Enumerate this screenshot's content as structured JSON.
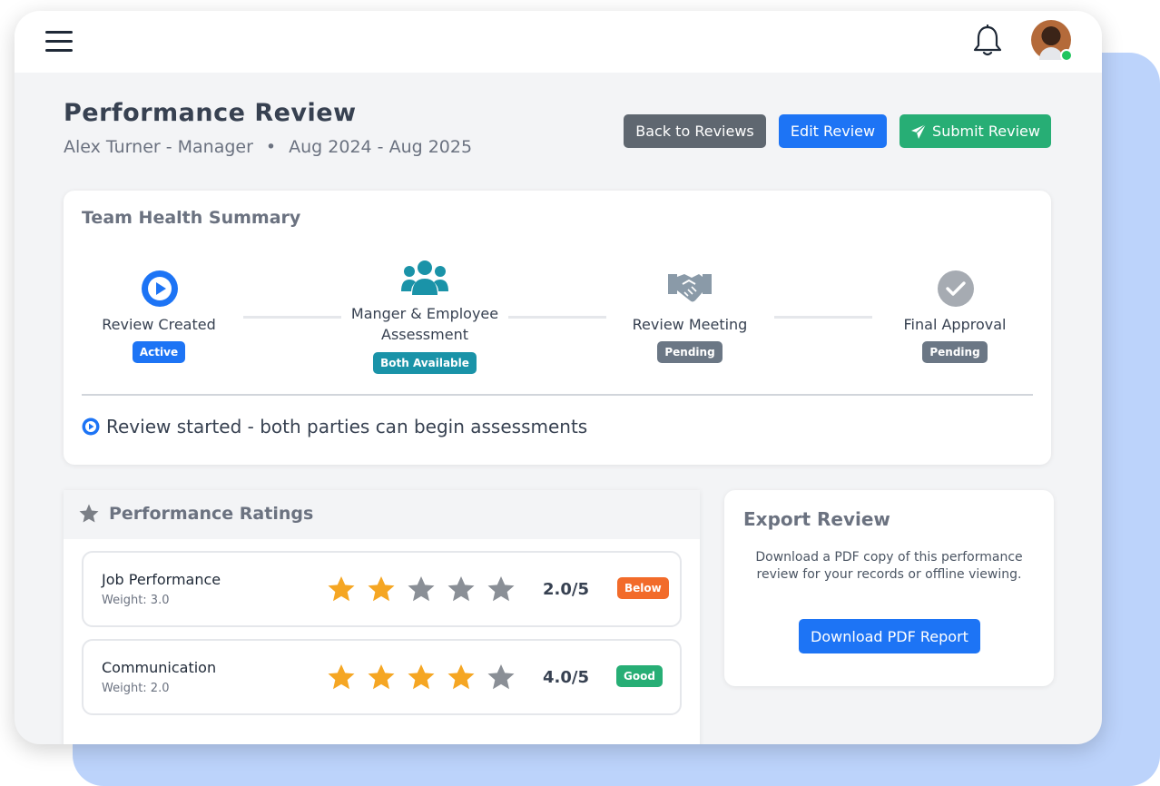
{
  "header": {
    "menu_icon": "hamburger-menu-icon",
    "notifications_icon": "bell-icon",
    "avatar_status": "online"
  },
  "page": {
    "title": "Performance Review",
    "employee": "Alex Turner - Manager",
    "separator": "•",
    "period": "Aug 2024 - Aug 2025"
  },
  "actions": {
    "back_label": "Back to Reviews",
    "edit_label": "Edit Review",
    "submit_label": "Submit Review",
    "submit_icon": "paper-plane-icon"
  },
  "team_health": {
    "title": "Team Health Summary",
    "steps": [
      {
        "icon": "play-circle-icon",
        "label": "Review Created",
        "badge": "Active",
        "badge_color": "#1d74f5"
      },
      {
        "icon": "users-icon",
        "label_line1": "Manger & Employee",
        "label_line2": "Assessment",
        "badge": "Both Available",
        "badge_color": "#1a93a8"
      },
      {
        "icon": "handshake-icon",
        "label": "Review Meeting",
        "badge": "Pending",
        "badge_color": "#6b7785"
      },
      {
        "icon": "check-circle-icon",
        "label": "Final Approval",
        "badge": "Pending",
        "badge_color": "#6b7785"
      }
    ],
    "status_text": "Review started - both parties can begin assessments"
  },
  "ratings": {
    "title": "Performance Ratings",
    "items": [
      {
        "name": "Job Performance",
        "weight": "Weight: 3.0",
        "stars_filled": 2,
        "stars_total": 5,
        "score": "2.0/5",
        "badge": "Below",
        "badge_color": "#f26b2a"
      },
      {
        "name": "Communication",
        "weight": "Weight: 2.0",
        "stars_filled": 4,
        "stars_total": 5,
        "score": "4.0/5",
        "badge": "Good",
        "badge_color": "#27ae75"
      }
    ]
  },
  "export": {
    "title": "Export Review",
    "description": "Download a PDF copy of this performance review for your records or offline viewing.",
    "button_label": "Download PDF Report"
  },
  "colors": {
    "primary": "#1d74f5",
    "success": "#27ae75",
    "secondary": "#5f6770",
    "star_filled": "#f5a623",
    "star_empty": "#8a8f96",
    "teal": "#1a93a8"
  }
}
